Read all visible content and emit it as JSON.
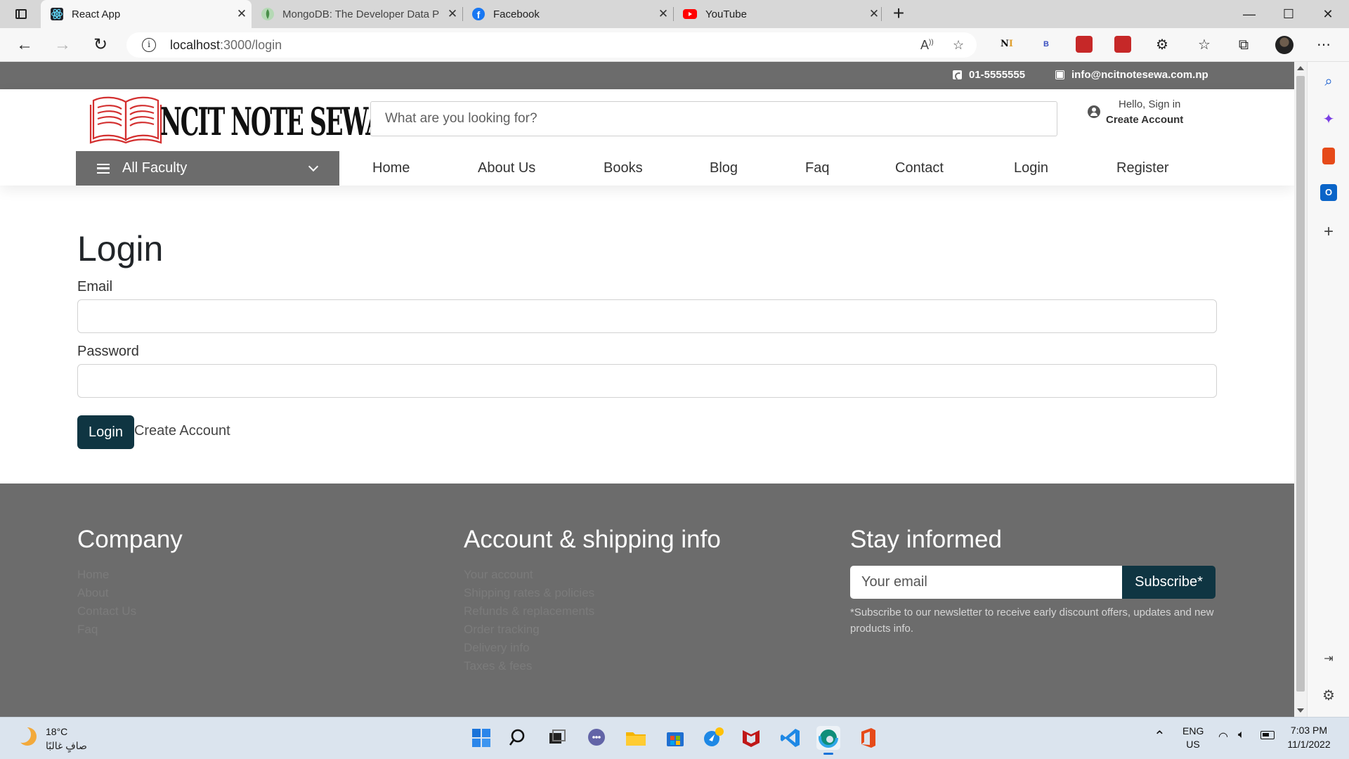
{
  "browser": {
    "tabs": [
      {
        "title": "React App",
        "active": true
      },
      {
        "title": "MongoDB: The Developer Data P",
        "active": false
      },
      {
        "title": "Facebook",
        "active": false
      },
      {
        "title": "YouTube",
        "active": false
      }
    ],
    "url_host": "localhost",
    "url_path": ":3000/login",
    "window_controls": {
      "minimize": "—",
      "maximize": "☐",
      "close": "✕"
    }
  },
  "site": {
    "topbar": {
      "phone": "01-5555555",
      "email": "info@ncitnotesewa.com.np"
    },
    "logo_text": "NCIT NOTE SEWA",
    "search_placeholder": "What are you looking for?",
    "account": {
      "greeting": "Hello, Sign in",
      "create": "Create Account"
    },
    "category_label": "All Faculty",
    "nav": [
      "Home",
      "About Us",
      "Books",
      "Blog",
      "Faq",
      "Contact",
      "Login",
      "Register"
    ]
  },
  "login": {
    "heading": "Login",
    "email_label": "Email",
    "password_label": "Password",
    "submit_label": "Login",
    "create_account_link": "Create Account"
  },
  "footer": {
    "company": {
      "title": "Company",
      "links": [
        "Home",
        "About",
        "Contact Us",
        "Faq"
      ]
    },
    "account": {
      "title": "Account & shipping info",
      "links": [
        "Your account",
        "Shipping rates & policies",
        "Refunds & replacements",
        "Order tracking",
        "Delivery info",
        "Taxes & fees"
      ]
    },
    "newsletter": {
      "title": "Stay informed",
      "placeholder": "Your email",
      "button": "Subscribe*",
      "note": "*Subscribe to our newsletter to receive early discount offers, updates and new products info."
    }
  },
  "taskbar": {
    "weather_temp": "18°C",
    "weather_desc": "صافٍ غالبًا",
    "lang_top": "ENG",
    "lang_bottom": "US",
    "time": "7:03 PM",
    "date": "11/1/2022"
  },
  "colors": {
    "primary": "#0f3542",
    "gray": "#6c6c6c",
    "logo_red": "#d32f2f"
  }
}
